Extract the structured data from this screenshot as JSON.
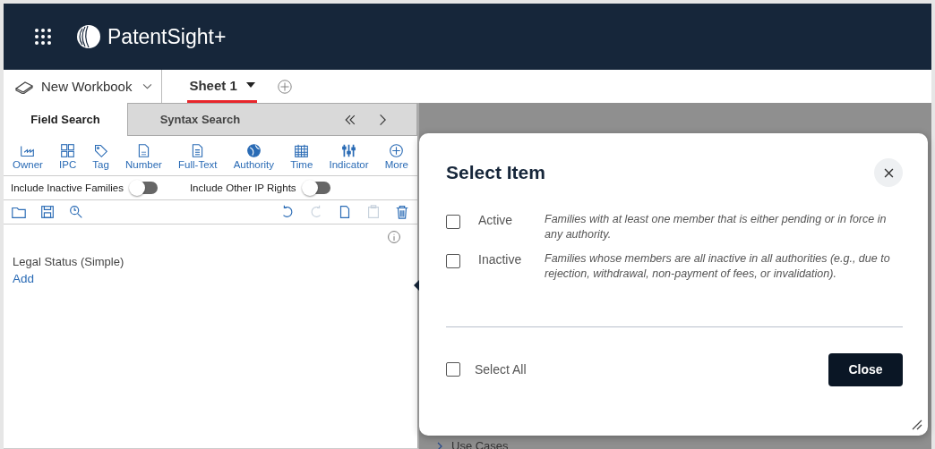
{
  "header": {
    "app_name": "PatentSight+"
  },
  "workbook": {
    "name": "New Workbook"
  },
  "sheets": [
    {
      "label": "Sheet 1",
      "selected": true
    }
  ],
  "panel_tabs": [
    {
      "label": "Field Search",
      "selected": true
    },
    {
      "label": "Syntax Search",
      "selected": false
    }
  ],
  "field_buttons": [
    {
      "label": "Owner",
      "kind": "factory"
    },
    {
      "label": "IPC",
      "kind": "grid"
    },
    {
      "label": "Tag",
      "kind": "tag"
    },
    {
      "label": "Number",
      "kind": "doc-ep"
    },
    {
      "label": "Full-Text",
      "kind": "doc"
    },
    {
      "label": "Authority",
      "kind": "globe"
    },
    {
      "label": "Time",
      "kind": "calendar"
    },
    {
      "label": "Indicator",
      "kind": "sliders"
    },
    {
      "label": "More",
      "kind": "plus"
    }
  ],
  "toggles": [
    {
      "label": "Include Inactive Families",
      "on": false
    },
    {
      "label": "Include Other IP Rights",
      "on": false
    }
  ],
  "actions": [
    {
      "kind": "folder",
      "disabled": false
    },
    {
      "kind": "save",
      "disabled": false
    },
    {
      "kind": "search-history",
      "disabled": false
    },
    {
      "kind": "undo",
      "disabled": false
    },
    {
      "kind": "redo",
      "disabled": true
    },
    {
      "kind": "copy",
      "disabled": false
    },
    {
      "kind": "paste",
      "disabled": true
    },
    {
      "kind": "trash",
      "disabled": false
    }
  ],
  "criteria": [
    {
      "label": "Legal Status (Simple)",
      "action": "Add"
    }
  ],
  "background_tree": [
    {
      "label": "Use Cases"
    }
  ],
  "dialog": {
    "title": "Select Item",
    "options": [
      {
        "label": "Active",
        "description": "Families with at least one member that is either pending or in force in any authority.",
        "checked": false
      },
      {
        "label": "Inactive",
        "description": "Families whose members are all inactive in all authorities (e.g., due to rejection, withdrawal, non-payment of fees, or invalidation).",
        "checked": false
      }
    ],
    "select_all": {
      "label": "Select All",
      "checked": false
    },
    "button": "Close"
  }
}
